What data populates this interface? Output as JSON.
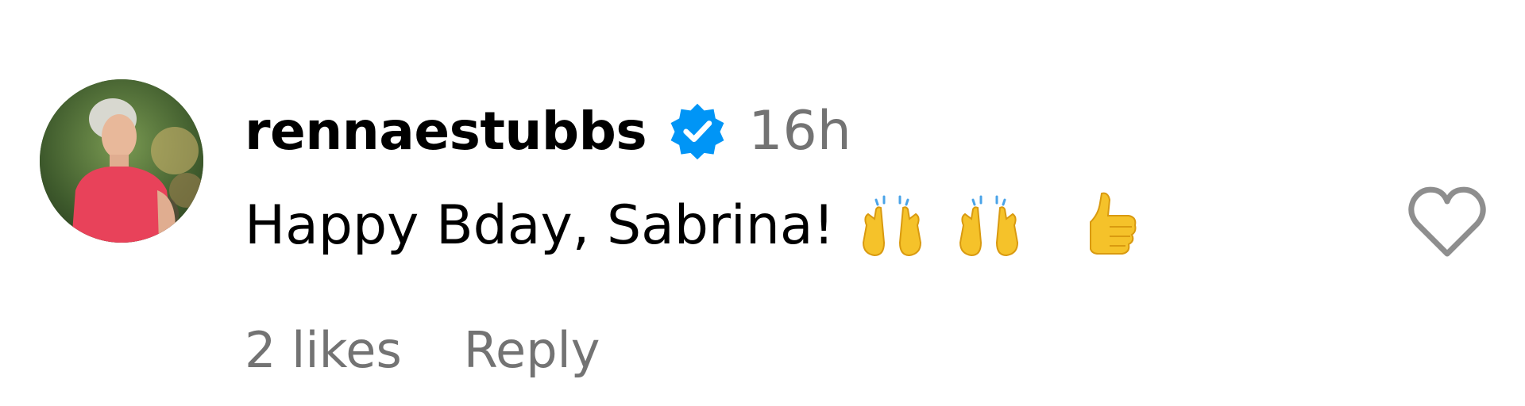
{
  "comment": {
    "username": "rennaestubbs",
    "verified": true,
    "timestamp": "16h",
    "text": "Happy Bday, Sabrina!",
    "emojis": [
      "raising-hands",
      "raising-hands",
      "thumbs-up"
    ],
    "likes_label": "2 likes",
    "reply_label": "Reply"
  },
  "colors": {
    "verified_blue": "#0095f6",
    "secondary_text": "#737373",
    "primary_text": "#000000",
    "heart_outline": "#8e8e8e"
  },
  "icons": {
    "verified": "verified-badge-icon",
    "like": "heart-outline-icon"
  }
}
